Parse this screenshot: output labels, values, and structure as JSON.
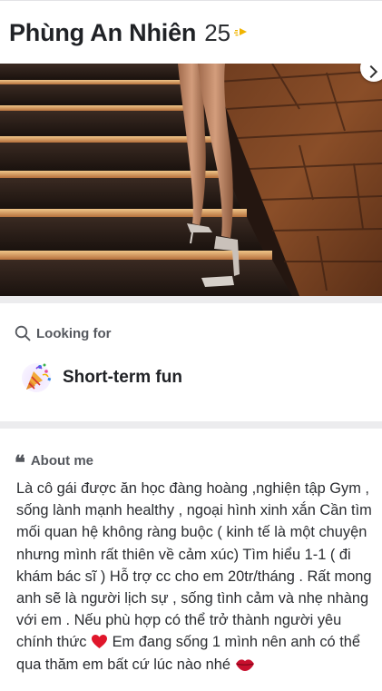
{
  "profile": {
    "name": "Phùng An Nhiên",
    "age": "25"
  },
  "icons": {
    "badge": "wave-badge-icon",
    "photo_more": "chevron-icon",
    "looking_for": "search-icon",
    "relationship": "party-popper-icon",
    "about": "quote-icon",
    "heart": "red-heart-icon",
    "lips": "kiss-lips-icon"
  },
  "looking_for": {
    "label": "Looking for",
    "value": "Short-term fun"
  },
  "about": {
    "label": "About me",
    "text_part1": "Là cô gái được ăn học đàng hoàng ,nghiện tập Gym , sống lành mạnh healthy , ngoại hình xinh xắn Cần tìm mối quan hệ không ràng buộc ( kinh tế là một chuyện nhưng mình rất thiên về cảm xúc) Tìm hiểu 1-1 ( đi khám bác sĩ ) Hỗ trợ cc cho em 20tr/tháng . Rất mong anh sẽ là người lịch sự , sống tình cảm và nhẹ nhàng với em . Nếu phù hợp có thể trở thành người yêu chính thức",
    "text_part2": " Em đang sống 1 mình nên anh có thể qua thăm em bất cứ lúc nào nhé"
  },
  "colors": {
    "accent_badge": "#f0b400",
    "heart": "#e0162b",
    "lips": "#c8102e"
  }
}
